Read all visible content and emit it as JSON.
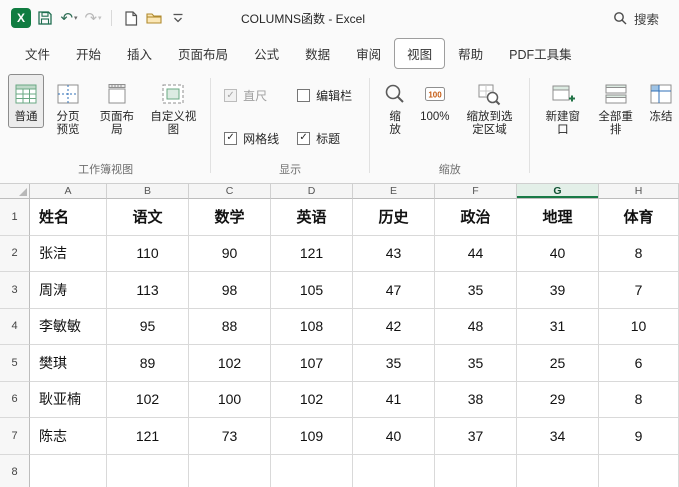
{
  "titlebar": {
    "logo_letter": "X",
    "title": "COLUMNS函数 - Excel",
    "search_label": "搜索"
  },
  "tabs": {
    "items": [
      {
        "label": "文件"
      },
      {
        "label": "开始"
      },
      {
        "label": "插入"
      },
      {
        "label": "页面布局"
      },
      {
        "label": "公式"
      },
      {
        "label": "数据"
      },
      {
        "label": "审阅"
      },
      {
        "label": "视图",
        "active": true
      },
      {
        "label": "帮助"
      },
      {
        "label": "PDF工具集"
      }
    ]
  },
  "ribbon": {
    "workbook_views": {
      "label": "工作簿视图",
      "buttons": [
        {
          "label": "普通",
          "selected": true
        },
        {
          "label": "分页预览"
        },
        {
          "label": "页面布局"
        },
        {
          "label": "自定义视图"
        }
      ]
    },
    "show": {
      "label": "显示",
      "checkboxes": [
        {
          "id": "ruler-checkbox",
          "label": "直尺",
          "checked": true,
          "disabled": true
        },
        {
          "id": "formula-bar-checkbox",
          "label": "编辑栏",
          "checked": false,
          "disabled": false
        },
        {
          "id": "gridlines-checkbox",
          "label": "网格线",
          "checked": true,
          "disabled": false
        },
        {
          "id": "headings-checkbox",
          "label": "标题",
          "checked": true,
          "disabled": false
        }
      ]
    },
    "zoom": {
      "label": "缩放",
      "buttons": [
        {
          "label": "缩放"
        },
        {
          "label": "100%"
        },
        {
          "label": "缩放到选定区域"
        }
      ]
    },
    "window": {
      "buttons": [
        {
          "label": "新建窗口"
        },
        {
          "label": "全部重排"
        },
        {
          "label": "冻结"
        }
      ]
    }
  },
  "grid": {
    "columns": [
      "A",
      "B",
      "C",
      "D",
      "E",
      "F",
      "G",
      "H"
    ],
    "selected_column": "G",
    "row_numbers": [
      "1",
      "2",
      "3",
      "4",
      "5",
      "6",
      "7",
      "8"
    ],
    "rows": [
      {
        "header": true,
        "cells": [
          "姓名",
          "语文",
          "数学",
          "英语",
          "历史",
          "政治",
          "地理",
          "体育"
        ]
      },
      {
        "cells": [
          "张洁",
          "110",
          "90",
          "121",
          "43",
          "44",
          "40",
          "8"
        ]
      },
      {
        "cells": [
          "周涛",
          "113",
          "98",
          "105",
          "47",
          "35",
          "39",
          "7"
        ]
      },
      {
        "cells": [
          "李敏敏",
          "95",
          "88",
          "108",
          "42",
          "48",
          "31",
          "10"
        ]
      },
      {
        "cells": [
          "樊琪",
          "89",
          "102",
          "107",
          "35",
          "35",
          "25",
          "6"
        ]
      },
      {
        "cells": [
          "耿亚楠",
          "102",
          "100",
          "102",
          "41",
          "38",
          "29",
          "8"
        ]
      },
      {
        "cells": [
          "陈志",
          "121",
          "73",
          "109",
          "40",
          "37",
          "34",
          "9"
        ]
      },
      {
        "cells": [
          "",
          "",
          "",
          "",
          "",
          "",
          "",
          ""
        ]
      }
    ]
  },
  "colors": {
    "excel_green": "#107c41",
    "selected_column_accent": "#187a46",
    "tab_active_border": "#9e9e9e"
  }
}
